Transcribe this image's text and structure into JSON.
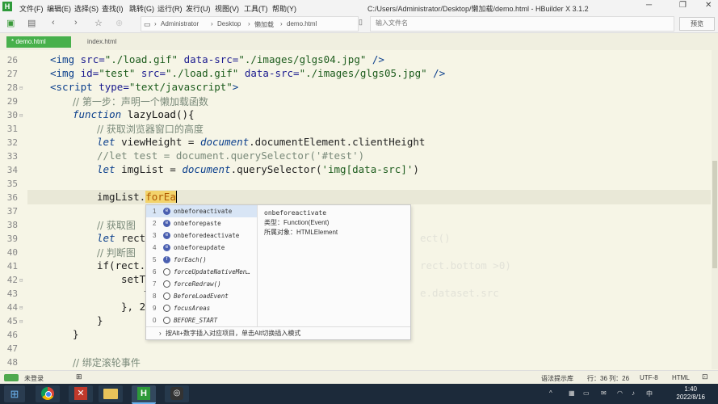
{
  "menu": {
    "items": [
      "文件(F)",
      "编辑(E)",
      "选择(S)",
      "查找(I)",
      "跳转(G)",
      "运行(R)",
      "发行(U)",
      "视图(V)",
      "工具(T)",
      "帮助(Y)"
    ],
    "window_path": "C:/Users/Administrator/Desktop/懒加载/demo.html - HBuilder X 3.1.2"
  },
  "toolbar": {
    "breadcrumbs": [
      "Administrator",
      "Desktop",
      "懒加载",
      "demo.html"
    ],
    "file_input_placeholder": "输入文件名",
    "preview_label": "预览"
  },
  "tabs": [
    {
      "label": "* demo.html",
      "active": true
    },
    {
      "label": "index.html",
      "active": false
    }
  ],
  "editor": {
    "line_numbers": [
      "26",
      "27",
      "28",
      "29",
      "30",
      "31",
      "32",
      "33",
      "34",
      "35",
      "36",
      "37",
      "38",
      "39",
      "40",
      "41",
      "42",
      "43",
      "44",
      "45",
      "46",
      "47",
      "48"
    ],
    "lines": {
      "l26": [
        "<img ",
        "src=",
        "\"./load.gif\"",
        " data-src=",
        "\"./images/glgs04.jpg\"",
        " />"
      ],
      "l27": [
        "<img ",
        "id=",
        "\"test\"",
        " src=",
        "\"./load.gif\"",
        " data-src=",
        "\"./images/glgs05.jpg\"",
        " />"
      ],
      "l28": [
        "<script ",
        "type=",
        "\"text/javascript\"",
        ">"
      ],
      "l29": "// 第一步：声明一个懒加载函数",
      "l30": [
        "function",
        " lazyLoad(){"
      ],
      "l31": "// 获取浏览器窗口的高度",
      "l32": [
        "let",
        " viewHeight = ",
        "document",
        ".documentElement.clientHeight"
      ],
      "l33": "//let test = document.querySelector('#test')",
      "l34": [
        "let",
        " imgList = ",
        "document",
        ".querySelector(",
        "'img[data-src]'",
        ")"
      ],
      "l36": [
        "imgList.",
        "forEa"
      ],
      "l38": "// 获取图",
      "l39": [
        "let",
        " rect"
      ],
      "l40": "// 判断图",
      "l41": "if(rect.t",
      "l42": "setT",
      "l43": "t",
      "l44": "}, 20",
      "l45": "}",
      "l46": "}",
      "l48": "// 绑定滚轮事件"
    },
    "ghost_text": [
      "ect()",
      "rect.bottom >0)",
      "e.dataset.src"
    ]
  },
  "completion": {
    "items": [
      {
        "num": "1",
        "icon": "e",
        "label": "onbeforeactivate",
        "italic": false
      },
      {
        "num": "2",
        "icon": "e",
        "label": "onbeforepaste",
        "italic": false
      },
      {
        "num": "3",
        "icon": "e",
        "label": "onbeforedeactivate",
        "italic": false
      },
      {
        "num": "4",
        "icon": "e",
        "label": "onbeforeupdate",
        "italic": false
      },
      {
        "num": "5",
        "icon": "f",
        "label": "forEach()",
        "italic": true
      },
      {
        "num": "6",
        "icon": "p",
        "label": "forceUpdateNativeMen…",
        "italic": true
      },
      {
        "num": "7",
        "icon": "p",
        "label": "forceRedraw()",
        "italic": true
      },
      {
        "num": "8",
        "icon": "p",
        "label": "BeforeLoadEvent",
        "italic": true
      },
      {
        "num": "9",
        "icon": "p",
        "label": "focusAreas",
        "italic": true
      },
      {
        "num": "0",
        "icon": "p",
        "label": "BEFORE_START",
        "italic": true
      }
    ],
    "detail_name": "onbeforeactivate",
    "detail_type": "类型：Function(Event)",
    "detail_owner": "所属对象：HTMLElement",
    "footer": "按Alt+数字插入对应项目，单击Alt切换插入模式"
  },
  "status": {
    "login": "未登录",
    "hint": "语法提示库",
    "position": "行：36 列：26",
    "encoding": "UTF-8",
    "lang": "HTML"
  },
  "clock": {
    "time": "1:40",
    "date": "2022/8/16"
  },
  "colors": {
    "tab_active": "#47b04b",
    "editor_bg": "#f6f5e6",
    "taskbar_bg": "#1c2a3a"
  }
}
